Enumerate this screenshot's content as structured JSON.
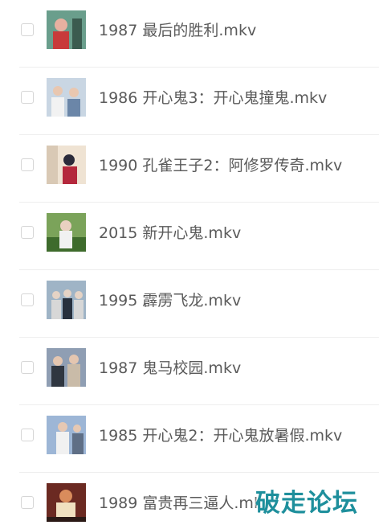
{
  "files": [
    {
      "name": "1987 最后的胜利.mkv",
      "thumb": {
        "colors": [
          "#6a9e8c",
          "#e8b0a0",
          "#c83a3a",
          "#3b5b4f"
        ]
      }
    },
    {
      "name": "1986 开心鬼3：开心鬼撞鬼.mkv",
      "thumb": {
        "colors": [
          "#c9d6e3",
          "#e9c7b0",
          "#f2f2f2",
          "#6b86a8"
        ]
      }
    },
    {
      "name": "1990 孔雀王子2：阿修罗传奇.mkv",
      "thumb": {
        "colors": [
          "#d9c9b5",
          "#2a2a3a",
          "#b4283c",
          "#efe3d3"
        ]
      }
    },
    {
      "name": "2015 新开心鬼.mkv",
      "thumb": {
        "colors": [
          "#7ba35a",
          "#f1f1f1",
          "#3e6b2c",
          "#e9d0c0"
        ]
      }
    },
    {
      "name": "1995 霹雳飞龙.mkv",
      "thumb": {
        "colors": [
          "#9fb4c6",
          "#e5d3c5",
          "#27303d",
          "#d7d7d7"
        ]
      }
    },
    {
      "name": "1987 鬼马校园.mkv",
      "thumb": {
        "colors": [
          "#8f9eb3",
          "#2f3640",
          "#e4c6b0",
          "#c9bba8"
        ]
      }
    },
    {
      "name": "1985 开心鬼2：开心鬼放暑假.mkv",
      "thumb": {
        "colors": [
          "#9db6d6",
          "#e6c8b3",
          "#f1f1f1",
          "#5f6f86"
        ]
      }
    },
    {
      "name": "1989 富贵再三逼人.mkv",
      "thumb": {
        "colors": [
          "#6b2a22",
          "#d98c5c",
          "#f0e0c0",
          "#2b1a16"
        ]
      }
    }
  ],
  "watermark": {
    "text": "破走论坛"
  }
}
